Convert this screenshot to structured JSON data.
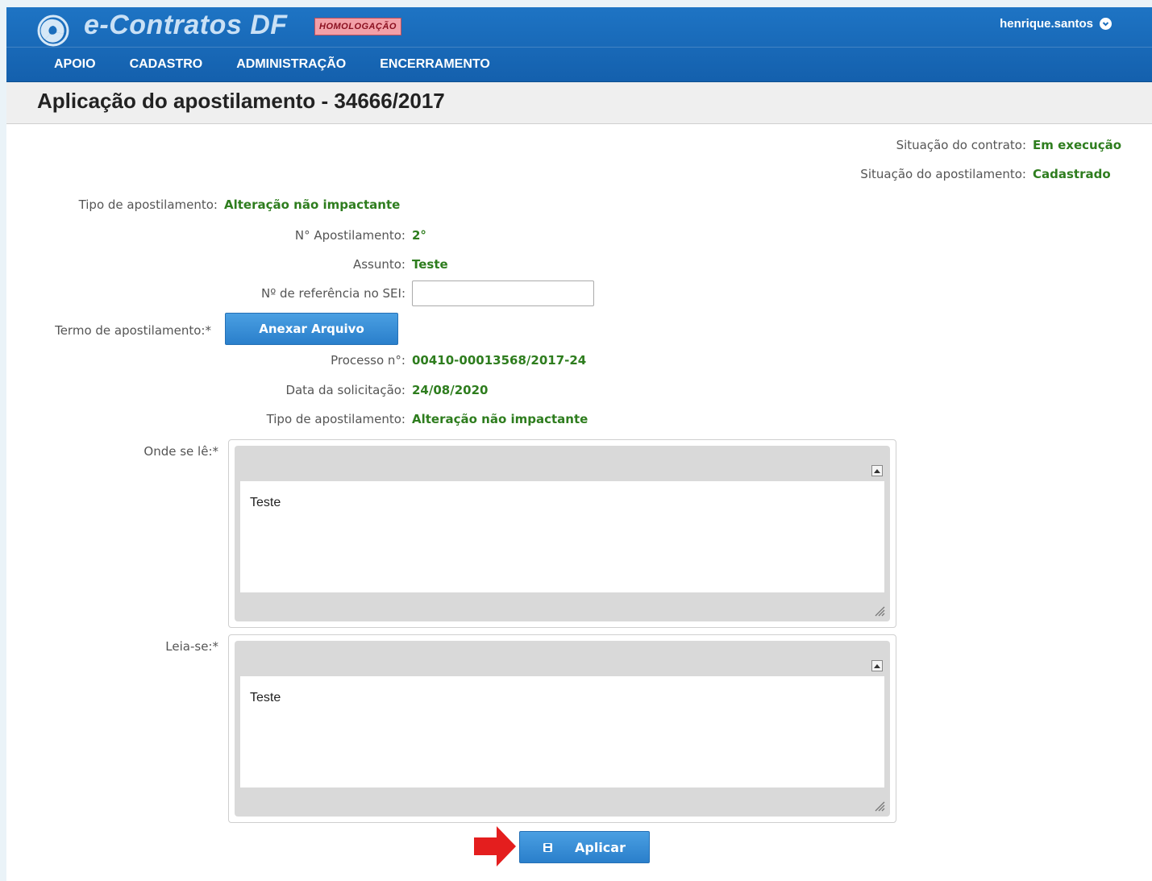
{
  "app": {
    "name": "e-Contratos DF",
    "environment_badge": "HOMOLOGAÇÃO",
    "user": "henrique.santos"
  },
  "nav": {
    "items": [
      {
        "label": "APOIO"
      },
      {
        "label": "CADASTRO"
      },
      {
        "label": "ADMINISTRAÇÃO"
      },
      {
        "label": "ENCERRAMENTO"
      }
    ]
  },
  "page": {
    "title": "Aplicação do apostilamento - 34666/2017"
  },
  "status": {
    "contract_label": "Situação do contrato:",
    "contract_value": "Em execução",
    "apostille_label": "Situação do apostilamento:",
    "apostille_value": "Cadastrado"
  },
  "form": {
    "type_top_label": "Tipo de apostilamento:",
    "type_top_value": "Alteração não impactante",
    "number_label": "N° Apostilamento:",
    "number_value": "2°",
    "subject_label": "Assunto:",
    "subject_value": "Teste",
    "sei_label": "Nº de referência no SEI:",
    "sei_value": "",
    "term_label": "Termo de apostilamento:*",
    "attach_button": "Anexar Arquivo",
    "process_label": "Processo n°:",
    "process_value": "00410-00013568/2017-24",
    "request_date_label": "Data da solicitação:",
    "request_date_value": "24/08/2020",
    "type_label": "Tipo de apostilamento:",
    "type_value": "Alteração não impactante",
    "where_reads_label": "Onde se lê:*",
    "where_reads_text": "Teste",
    "read_as_label": "Leia-se:*",
    "read_as_text": "Teste",
    "apply_button": "Aplicar"
  },
  "colors": {
    "header_blue": "#1a6dbd",
    "value_green": "#2e7d1e",
    "button_blue": "#3b8fd8",
    "arrow_red": "#e41e1e"
  },
  "icons": {
    "logo": "e-contratos-logo-icon",
    "user_caret": "chevron-down-circle-icon",
    "apply": "save-icon",
    "annotation": "red-arrow-icon"
  }
}
